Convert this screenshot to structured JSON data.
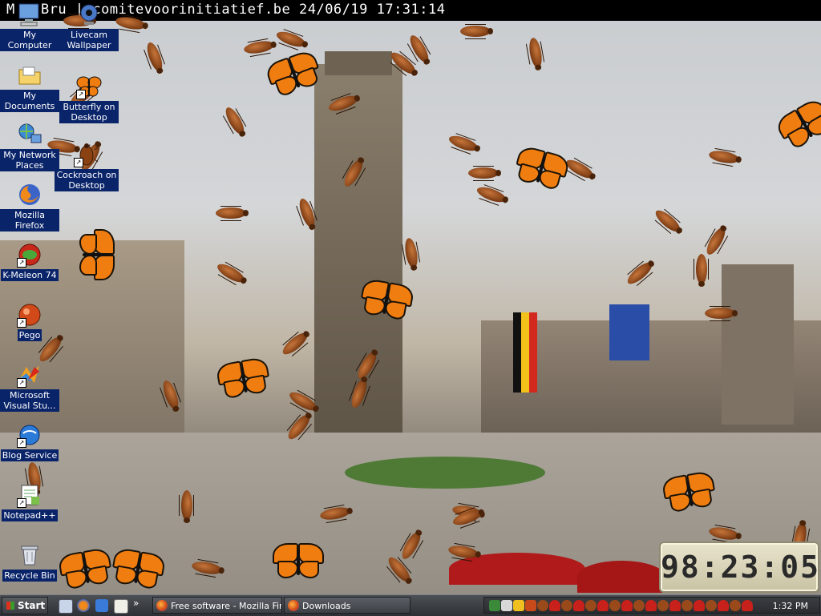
{
  "wallpaper": {
    "caption": "M    t Bru     | comitevoorinitiatief.be 24/06/19 17:31:14",
    "colors": {
      "sky": "#d4d6d8",
      "tower": "#7a6e5e",
      "flag_eu": "#2a4ea8"
    }
  },
  "desktop_icons": [
    {
      "name": "my-computer",
      "label": "My Computer",
      "icon": "computer-icon"
    },
    {
      "name": "livecam-wallpaper",
      "label": "Livecam Wallpaper",
      "icon": "webcam-icon"
    },
    {
      "name": "my-documents",
      "label": "My Documents",
      "icon": "folder-icon"
    },
    {
      "name": "butterfly-on-desktop",
      "label": "Butterfly on Desktop",
      "icon": "butterfly-icon"
    },
    {
      "name": "my-network-places",
      "label": "My Network Places",
      "icon": "network-icon"
    },
    {
      "name": "cockroach-on-desktop",
      "label": "Cockroach on Desktop",
      "icon": "cockroach-icon"
    },
    {
      "name": "mozilla-firefox",
      "label": "Mozilla Firefox",
      "icon": "firefox-icon"
    },
    {
      "name": "k-meleon",
      "label": "K-Meleon 74",
      "icon": "k-meleon-icon"
    },
    {
      "name": "pego",
      "label": "Pego",
      "icon": "pego-icon"
    },
    {
      "name": "visual-studio",
      "label": "Microsoft Visual Stu...",
      "icon": "visual-studio-icon"
    },
    {
      "name": "blog-service",
      "label": "Blog Service",
      "icon": "blog-icon"
    },
    {
      "name": "notepad-plus",
      "label": "Notepad++",
      "icon": "notepad-icon"
    },
    {
      "name": "recycle-bin",
      "label": "Recycle Bin",
      "icon": "recycle-bin-icon"
    }
  ],
  "clock_widget": {
    "digits": "98:23:05"
  },
  "taskbar": {
    "start_label": "Start",
    "quick_launch": [
      "show-desktop-icon",
      "firefox-icon",
      "outlook-icon",
      "mail-icon"
    ],
    "tasks": [
      {
        "label": "Free software - Mozilla Fir...",
        "icon": "firefox-icon"
      },
      {
        "label": "Downloads",
        "icon": "firefox-icon"
      }
    ],
    "tray_time": "1:32 PM",
    "tray_colors": {
      "bug": "#9a4a1a",
      "heart": "#c8201a"
    }
  }
}
